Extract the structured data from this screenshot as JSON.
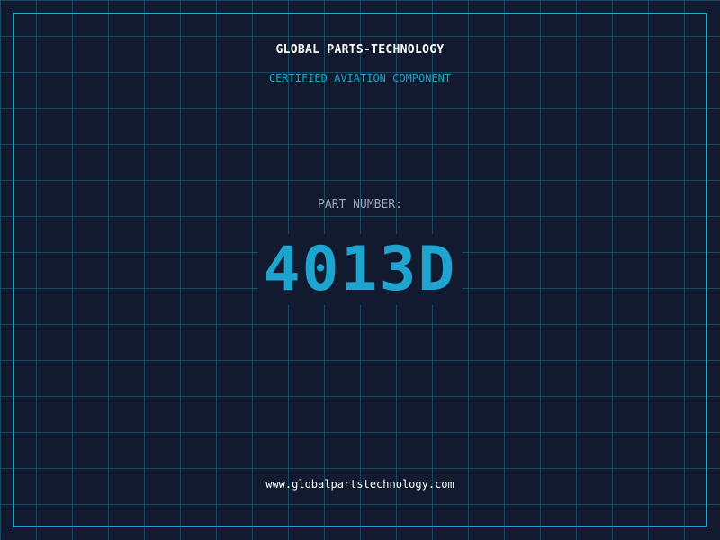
{
  "header": {
    "company_name": "GLOBAL PARTS-TECHNOLOGY",
    "tagline": "CERTIFIED AVIATION COMPONENT"
  },
  "part": {
    "label": "PART NUMBER:",
    "number": "4013D"
  },
  "footer": {
    "website": "www.globalpartstechnology.com"
  },
  "colors": {
    "background": "#111a2e",
    "grid": "#226e8c",
    "accent": "#1fa3cf",
    "text": "#ffffff",
    "muted": "#9aa6b8"
  }
}
